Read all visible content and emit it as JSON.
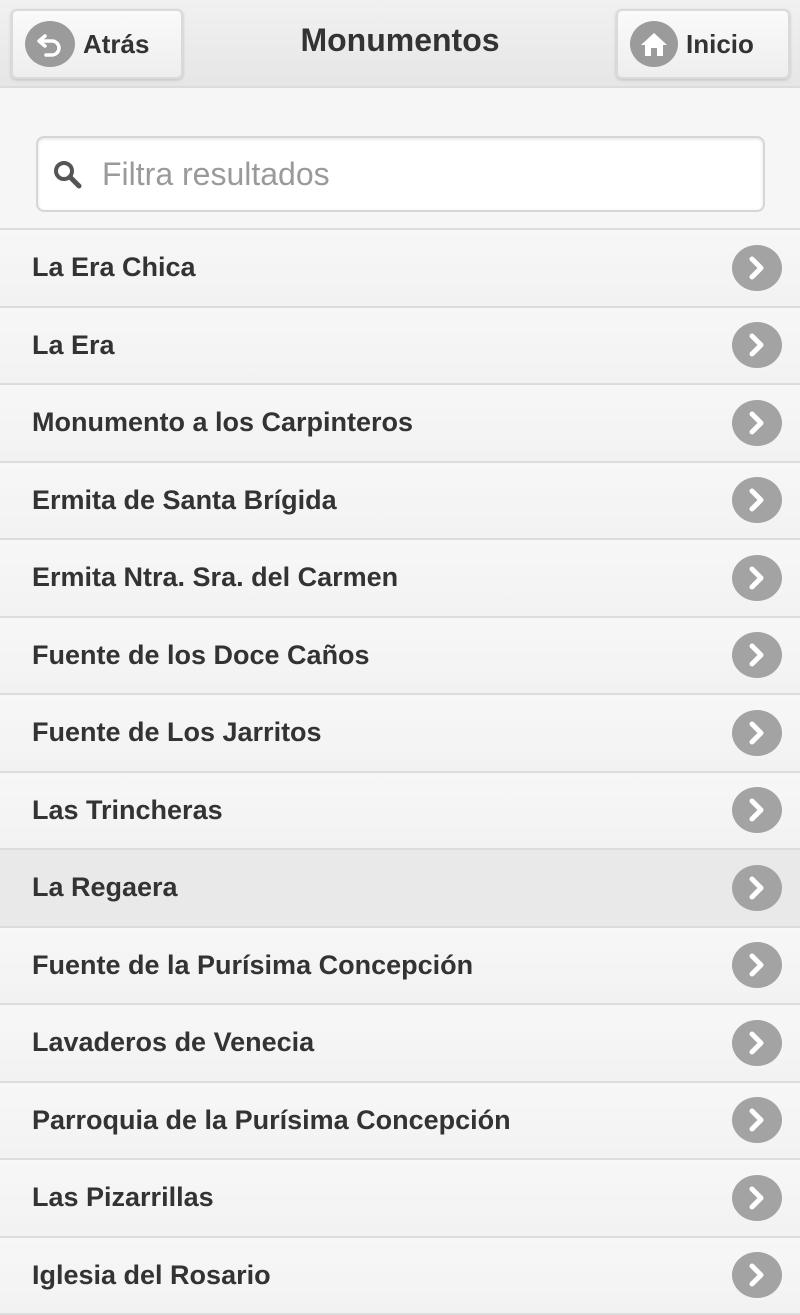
{
  "header": {
    "title": "Monumentos",
    "back_label": "Atrás",
    "home_label": "Inicio"
  },
  "search": {
    "placeholder": "Filtra resultados",
    "value": ""
  },
  "list": {
    "items": [
      {
        "label": "La Era Chica"
      },
      {
        "label": "La Era"
      },
      {
        "label": "Monumento a los Carpinteros"
      },
      {
        "label": "Ermita de Santa Brígida"
      },
      {
        "label": "Ermita Ntra. Sra. del Carmen"
      },
      {
        "label": "Fuente de los Doce Caños"
      },
      {
        "label": "Fuente de Los Jarritos"
      },
      {
        "label": "Las Trincheras"
      },
      {
        "label": "La Regaera"
      },
      {
        "label": "Fuente de la Purísima Concepción"
      },
      {
        "label": "Lavaderos de Venecia"
      },
      {
        "label": "Parroquia de la Purísima Concepción"
      },
      {
        "label": "Las Pizarrillas"
      },
      {
        "label": "Iglesia del Rosario"
      }
    ]
  },
  "icons": {
    "back": "back-arrow-icon",
    "home": "home-icon",
    "search": "search-icon",
    "row_arrow": "chevron-right-icon"
  },
  "colors": {
    "icon_gray": "#9b9b9b",
    "active_row": "#e9e9e9"
  }
}
